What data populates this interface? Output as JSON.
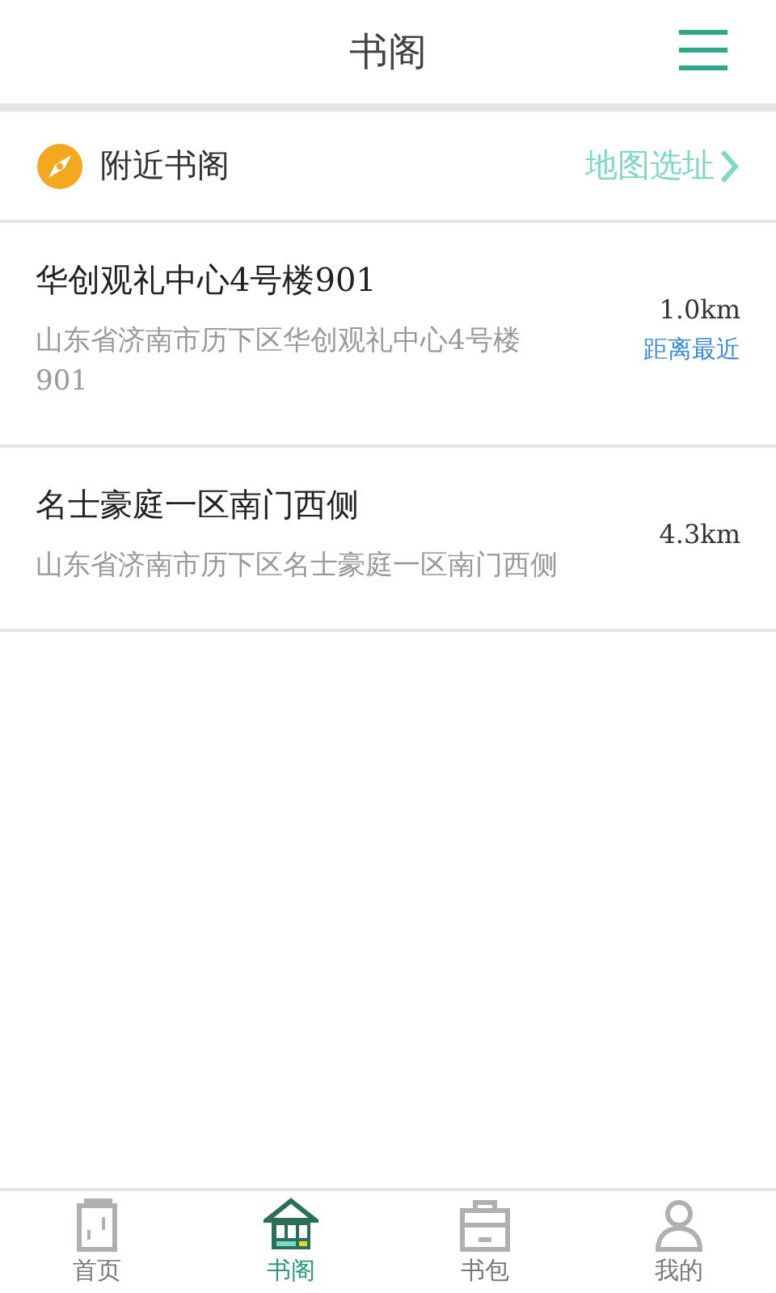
{
  "header": {
    "title": "书阁"
  },
  "nearby": {
    "label": "附近书阁",
    "link": "地图选址"
  },
  "stores": [
    {
      "name": "华创观礼中心4号楼901",
      "address": "山东省济南市历下区华创观礼中心4号楼901",
      "distance": "1.0km",
      "tag": "距离最近"
    },
    {
      "name": "名士豪庭一区南门西侧",
      "address": "山东省济南市历下区名士豪庭一区南门西侧",
      "distance": "4.3km"
    }
  ],
  "tabs": [
    {
      "kind": "home",
      "label": "首页",
      "selected": false
    },
    {
      "kind": "library",
      "label": "书阁",
      "selected": true
    },
    {
      "kind": "bag",
      "label": "书包",
      "selected": false
    },
    {
      "kind": "profile",
      "label": "我的",
      "selected": false
    }
  ]
}
